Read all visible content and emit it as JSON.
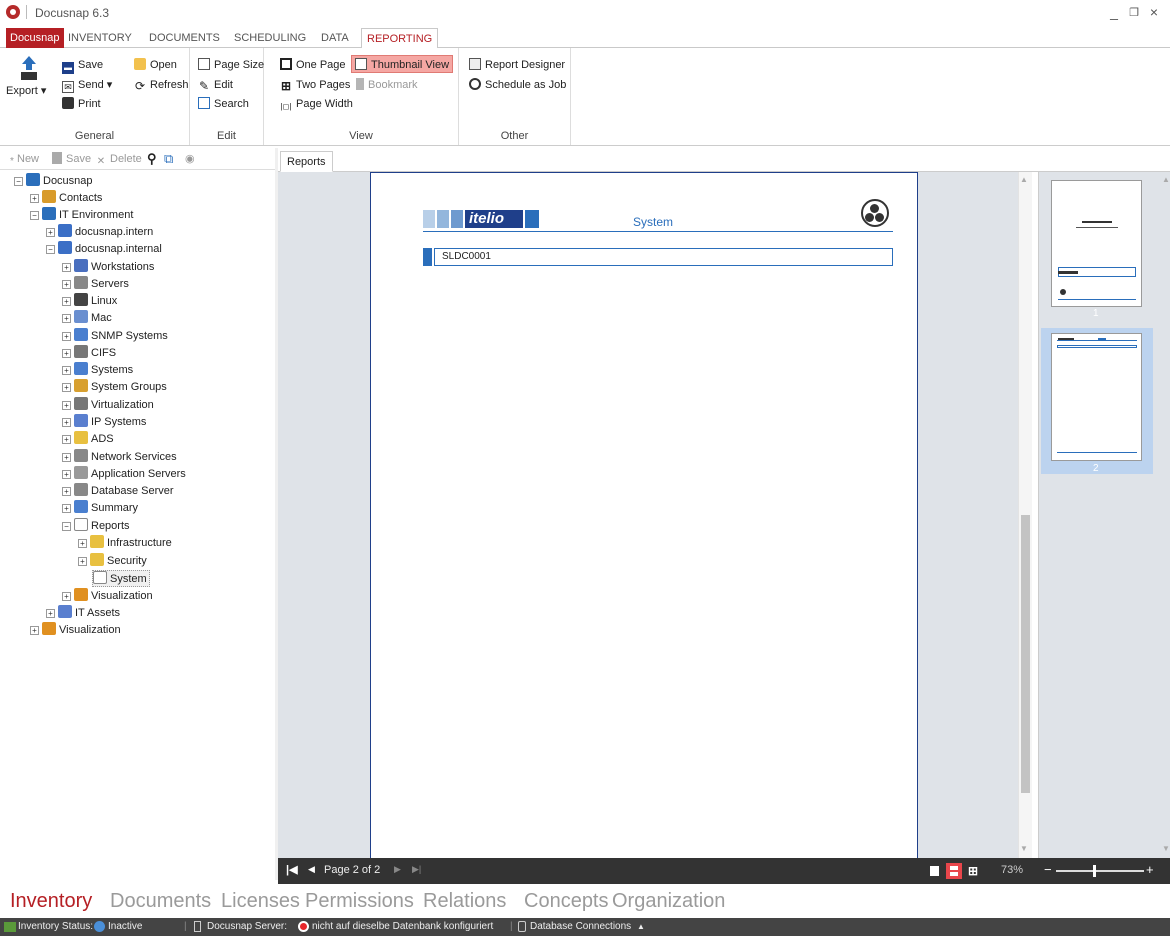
{
  "window": {
    "app_title": "Docusnap 6.3",
    "minimize": "_",
    "restore": "ẍ",
    "close": "×"
  },
  "menu": {
    "app": "Docusnap",
    "tabs": [
      "INVENTORY",
      "DOCUMENTS",
      "SCHEDULING",
      "DATA",
      "REPORTING"
    ]
  },
  "ribbon": {
    "general": {
      "label": "General",
      "export": "Export",
      "save": "Save",
      "send": "Send",
      "print": "Print",
      "open": "Open",
      "refresh": "Refresh"
    },
    "edit": {
      "label": "Edit",
      "page_size": "Page Size",
      "edit": "Edit",
      "search": "Search"
    },
    "view": {
      "label": "View",
      "one_page": "One Page",
      "two_pages": "Two Pages",
      "page_width": "Page Width",
      "thumbnail_view": "Thumbnail View",
      "bookmark": "Bookmark"
    },
    "other": {
      "label": "Other",
      "report_designer": "Report Designer",
      "schedule_as_job": "Schedule as Job"
    }
  },
  "left_toolbar": {
    "new": "New",
    "save": "Save",
    "delete": "Delete"
  },
  "tree": [
    {
      "label": "Docusnap",
      "level": 0
    },
    {
      "label": "Contacts",
      "level": 1
    },
    {
      "label": "IT Environment",
      "level": 1
    },
    {
      "label": "docusnap.intern",
      "level": 2
    },
    {
      "label": "docusnap.internal",
      "level": 2
    },
    {
      "label": "Workstations",
      "level": 3
    },
    {
      "label": "Servers",
      "level": 3
    },
    {
      "label": "Linux",
      "level": 3
    },
    {
      "label": "Mac",
      "level": 3
    },
    {
      "label": "SNMP Systems",
      "level": 3
    },
    {
      "label": "CIFS",
      "level": 3
    },
    {
      "label": "Systems",
      "level": 3
    },
    {
      "label": "System Groups",
      "level": 3
    },
    {
      "label": "Virtualization",
      "level": 3
    },
    {
      "label": "IP Systems",
      "level": 3
    },
    {
      "label": "ADS",
      "level": 3
    },
    {
      "label": "Network Services",
      "level": 3
    },
    {
      "label": "Application Servers",
      "level": 3
    },
    {
      "label": "Database Server",
      "level": 3
    },
    {
      "label": "Summary",
      "level": 3
    },
    {
      "label": "Reports",
      "level": 3
    },
    {
      "label": "Infrastructure",
      "level": 4
    },
    {
      "label": "Security",
      "level": 4
    },
    {
      "label": "System",
      "level": 4
    },
    {
      "label": "Visualization",
      "level": 3
    },
    {
      "label": "IT Assets",
      "level": 2
    },
    {
      "label": "Visualization",
      "level": 1
    }
  ],
  "doc": {
    "tab": "Reports",
    "logo_text": "itelio",
    "report_title": "System",
    "row_value": "SLDC0001",
    "thumb1_num": "1",
    "thumb2_num": "2"
  },
  "navbar": {
    "page_label": "Page 2 of 2",
    "zoom": "73%"
  },
  "bottom_nav": [
    "Inventory",
    "Documents",
    "Licenses",
    "Permissions",
    "Relations",
    "Concepts",
    "Organization"
  ],
  "status": {
    "inventory_status_label": "Inventory Status:",
    "inventory_status_value": "Inactive",
    "server_label": "Docusnap Server:",
    "server_value": "nicht auf dieselbe Datenbank konfiguriert",
    "db_connections": "Database Connections"
  },
  "colors": {
    "accent": "#b51f24",
    "highlight": "#f5a7a3",
    "report_blue": "#2a6ebb"
  }
}
